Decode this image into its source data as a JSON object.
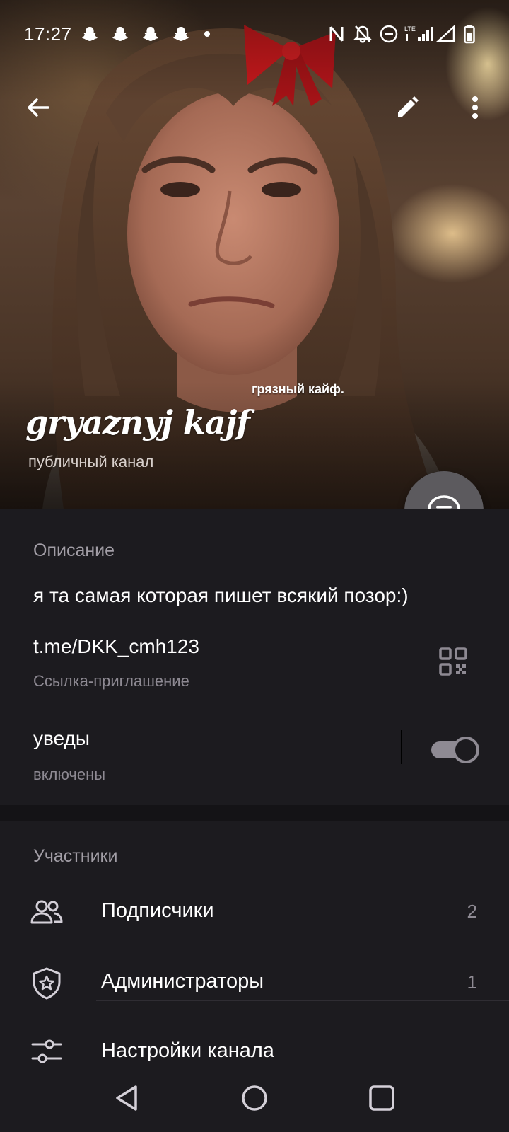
{
  "status_bar": {
    "time": "17:27",
    "icons": [
      "snapchat-icon",
      "snapchat-icon",
      "snapchat-icon",
      "snapchat-icon",
      "dot",
      "nfc-icon",
      "bell-off-icon",
      "do-not-disturb-icon",
      "lte-signal-icon",
      "signal-icon",
      "battery-icon"
    ]
  },
  "toolbar": {
    "back": "back-arrow-icon",
    "edit": "pencil-icon",
    "more": "more-vertical-icon"
  },
  "header": {
    "channel_name": "gryaznyj kajf",
    "sticker_text": "грязный кайф.",
    "channel_type": "публичный канал"
  },
  "info": {
    "description_header": "Описание",
    "description": "я та самая которая пишет всякий позор:)",
    "link": "t.me/DKK_cmh123",
    "link_caption": "Ссылка-приглашение",
    "notifications_label": "уведы",
    "notifications_status": "включены",
    "notifications_enabled": true
  },
  "members": {
    "header": "Участники",
    "items": [
      {
        "label": "Подписчики",
        "count": "2",
        "icon": "users-icon"
      },
      {
        "label": "Администраторы",
        "count": "1",
        "icon": "shield-star-icon"
      },
      {
        "label": "Настройки канала",
        "count": "",
        "icon": "sliders-icon"
      }
    ]
  },
  "colors": {
    "background": "#1c1b1f",
    "secondary_text": "#8e8a93",
    "fab": "#5c5a5e",
    "bow": "#c8191c"
  }
}
